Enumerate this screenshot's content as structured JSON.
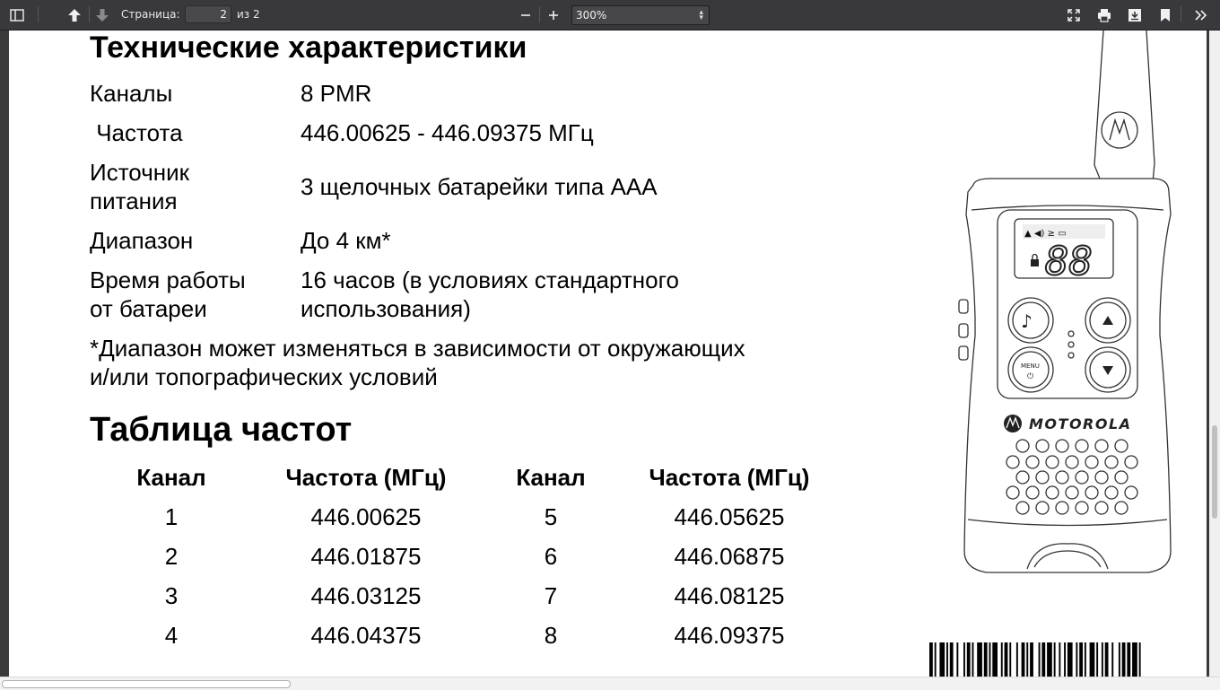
{
  "toolbar": {
    "page_label": "Страница:",
    "page_current": "2",
    "page_total": "из 2",
    "zoom_value": "300%"
  },
  "document": {
    "specs_title": "Технические характеристики",
    "specs": [
      {
        "label": "Каналы",
        "value": "8 PMR"
      },
      {
        "label": " Частота",
        "value": "446.00625 - 446.09375 МГц"
      },
      {
        "label_lines": [
          "Источник",
          "питания"
        ],
        "value": "3 щелочных батарейки типа AAA"
      },
      {
        "label": "Диапазон",
        "value": "До 4 км*"
      },
      {
        "label_lines": [
          "Время работы",
          "от батареи"
        ],
        "value_lines": [
          "16 часов (в условиях стандартного",
          "использования)"
        ]
      }
    ],
    "note_lines": [
      "*Диапазон может изменяться в зависимости от окружающих",
      "и/или топографических условий"
    ],
    "freq_title": "Таблица частот",
    "freq_table": {
      "headers": [
        "Канал",
        "Частота (МГц)",
        "Канал",
        "Частота (МГц)"
      ],
      "rows": [
        [
          "1",
          "446.00625",
          "5",
          "446.05625"
        ],
        [
          "2",
          "446.01875",
          "6",
          "446.06875"
        ],
        [
          "3",
          "446.03125",
          "7",
          "446.08125"
        ],
        [
          "4",
          "446.04375",
          "8",
          "446.09375"
        ]
      ]
    },
    "radio": {
      "brand": "MOTOROLA",
      "display_digits": "88",
      "menu_label": "MENU"
    }
  },
  "icons": [
    "sidebar-toggle-icon",
    "previous-page-icon",
    "next-page-icon",
    "zoom-out-icon",
    "zoom-in-icon",
    "presentation-mode-icon",
    "print-icon",
    "download-icon",
    "bookmark-icon",
    "tools-icon"
  ]
}
